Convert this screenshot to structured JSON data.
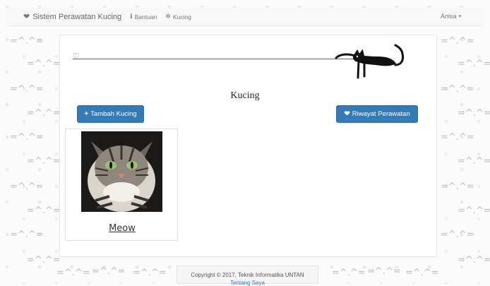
{
  "navbar": {
    "brand": "Sistem Perawatan Kucing",
    "links": [
      {
        "label": "Bantuan",
        "icon": "info-icon"
      },
      {
        "label": "Kucing",
        "icon": "cat-icon"
      }
    ],
    "user": "Anisa"
  },
  "page": {
    "title": "Kucing",
    "add_button": "Tambah Kucing",
    "history_button": "Riwayat Perawatan"
  },
  "cats": [
    {
      "name": "Meow"
    }
  ],
  "footer": {
    "copyright": "Copyright © 2017, Teknik Informatika UNTAN",
    "link": "Tentang Saya"
  },
  "colors": {
    "primary": "#337ab7",
    "navbar_bg": "#f8f8f8"
  }
}
